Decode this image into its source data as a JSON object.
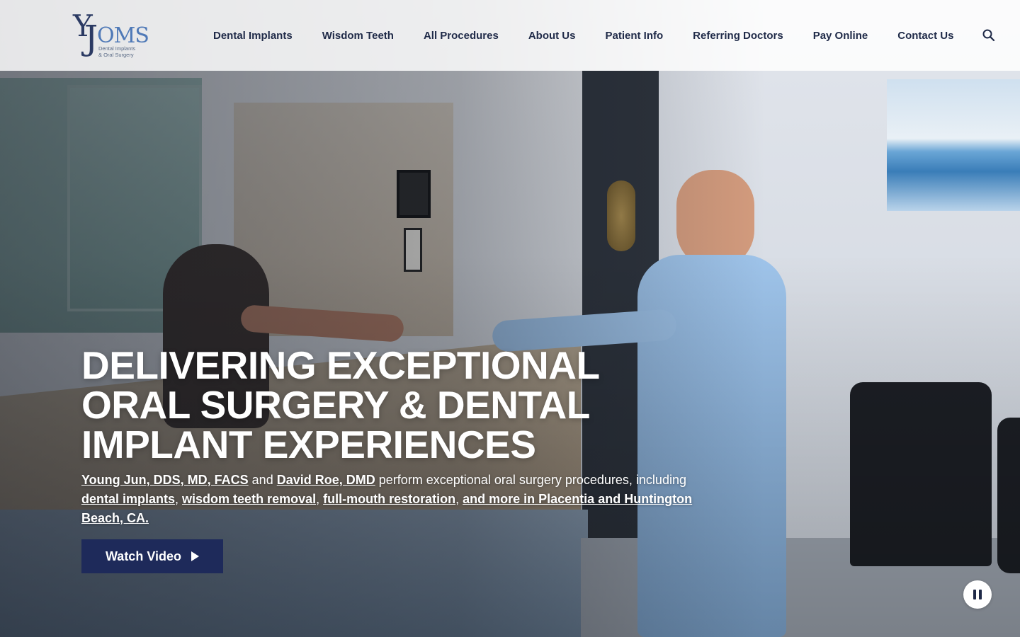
{
  "brand": {
    "logo_letters": "YJ",
    "logo_name": "OMS",
    "logo_tagline_line1": "Dental Implants",
    "logo_tagline_line2": "& Oral Surgery"
  },
  "nav": {
    "items": [
      {
        "label": "Dental Implants"
      },
      {
        "label": "Wisdom Teeth"
      },
      {
        "label": "All Procedures"
      },
      {
        "label": "About Us"
      },
      {
        "label": "Patient Info"
      },
      {
        "label": "Referring Doctors"
      },
      {
        "label": "Pay Online"
      },
      {
        "label": "Contact Us"
      }
    ],
    "search_icon": "search-icon"
  },
  "hero": {
    "headline_line1": "DELIVERING EXCEPTIONAL",
    "headline_line2": "ORAL SURGERY & DENTAL",
    "headline_line3": "IMPLANT EXPERIENCES",
    "intro": {
      "doctor1": "Young Jun, DDS, MD, FACS",
      "and": " and ",
      "doctor2": "David Roe, DMD",
      "text1": " perform exceptional oral surgery procedures, including ",
      "link1": "dental implants",
      "comma1": ", ",
      "link2": "wisdom teeth removal",
      "comma2": ", ",
      "link3": "full-mouth restoration",
      "comma3": ", ",
      "link4": "and more in Placentia and Huntington Beach, CA."
    },
    "watch_button": "Watch Video",
    "play_icon": "play-icon",
    "pause_icon": "pause-icon"
  },
  "colors": {
    "nav_text": "#1f2a48",
    "button_bg": "#1e2a5a",
    "logo_dark": "#2b3a63",
    "logo_accent": "#4f79b7"
  }
}
